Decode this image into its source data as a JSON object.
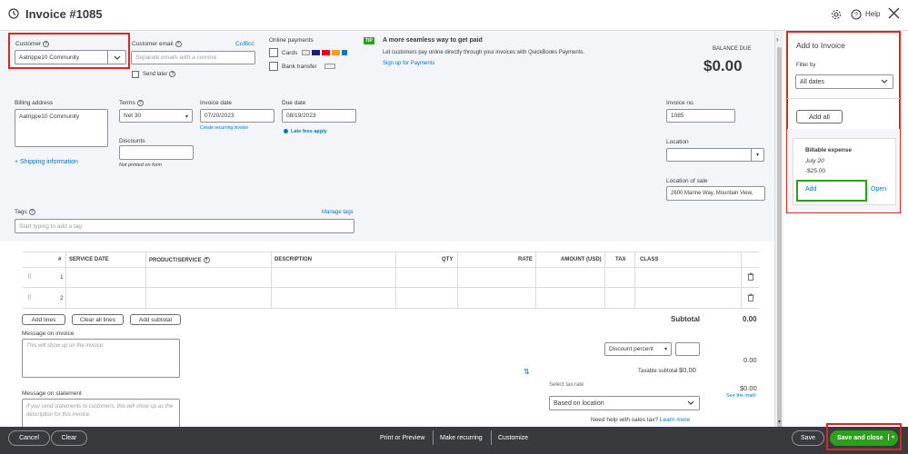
{
  "header": {
    "title": "Invoice #1085",
    "help": "Help"
  },
  "customer": {
    "label": "Customer",
    "value": "Aatrippe10 Community"
  },
  "email": {
    "label": "Customer email",
    "placeholder": "Separate emails with a comma",
    "cc": "Cc/Bcc",
    "send_later": "Send later"
  },
  "online_payments": {
    "label": "Online payments",
    "cards": "Cards",
    "bank": "Bank transfer"
  },
  "tip": {
    "badge": "TIP",
    "title": "A more seamless way to get paid",
    "body": "Let customers pay online directly through your invoices with QuickBooks Payments.",
    "link": "Sign up for Payments"
  },
  "balance": {
    "label": "BALANCE DUE",
    "amount": "$0.00"
  },
  "billing": {
    "label": "Billing address",
    "value": "Aatrippe10 Community"
  },
  "terms": {
    "label": "Terms",
    "value": "Net 30"
  },
  "invoice_date": {
    "label": "Invoice date",
    "value": "07/20/2023",
    "recurring": "Create recurring invoice"
  },
  "due_date": {
    "label": "Due date",
    "value": "08/19/2023",
    "late_fees": "Late fees apply"
  },
  "invoice_no": {
    "label": "Invoice no.",
    "value": "1085"
  },
  "discounts": {
    "label": "Discounts",
    "note": "Not printed on form"
  },
  "shipping": "+ Shipping information",
  "location": {
    "label": "Location"
  },
  "location_of_sale": {
    "label": "Location of sale",
    "value": "2600 Marine Way, Mountain View,"
  },
  "tags": {
    "label": "Tags",
    "manage": "Manage tags",
    "placeholder": "Start typing to add a tag"
  },
  "table": {
    "headers": [
      "#",
      "SERVICE DATE",
      "PRODUCT/SERVICE",
      "DESCRIPTION",
      "QTY",
      "RATE",
      "AMOUNT (USD)",
      "TAX",
      "CLASS"
    ],
    "rows": [
      {
        "num": "1"
      },
      {
        "num": "2"
      }
    ]
  },
  "table_buttons": {
    "add_lines": "Add lines",
    "clear_all": "Clear all lines",
    "add_subtotal": "Add subtotal"
  },
  "totals": {
    "subtotal_label": "Subtotal",
    "subtotal_value": "0.00",
    "discount_select": "Discount percent",
    "discount_value": "0.00",
    "taxable_label": "Taxable subtotal",
    "taxable_value": "$0.00",
    "tax_rate_label": "Select tax rate",
    "tax_rate_value": "Based on location",
    "tax_value": "$0.00",
    "see_math": "See the math",
    "sales_tax_help": "Need help with sales tax?",
    "learn_more": "Learn more"
  },
  "messages": {
    "invoice_label": "Message on invoice",
    "invoice_placeholder": "This will show up on the invoice.",
    "statement_label": "Message on statement",
    "statement_placeholder": "If you send statements to customers, this will show up as the description for this invoice."
  },
  "sidebar": {
    "title": "Add to Invoice",
    "filter_label": "Filter by",
    "filter_value": "All dates",
    "add_all": "Add all",
    "card": {
      "title": "Billable expense",
      "date": "July 20",
      "amount": "-$25.00",
      "add": "Add",
      "open": "Open"
    }
  },
  "footer": {
    "cancel": "Cancel",
    "clear": "Clear",
    "print": "Print or Preview",
    "recurring": "Make recurring",
    "customize": "Customize",
    "save": "Save",
    "save_close": "Save and close"
  },
  "colors": {
    "brand_green": "#2ca01c",
    "footer_bg": "#393a3d",
    "highlight_red": "#d52b1e",
    "link_blue": "#0077c5"
  }
}
